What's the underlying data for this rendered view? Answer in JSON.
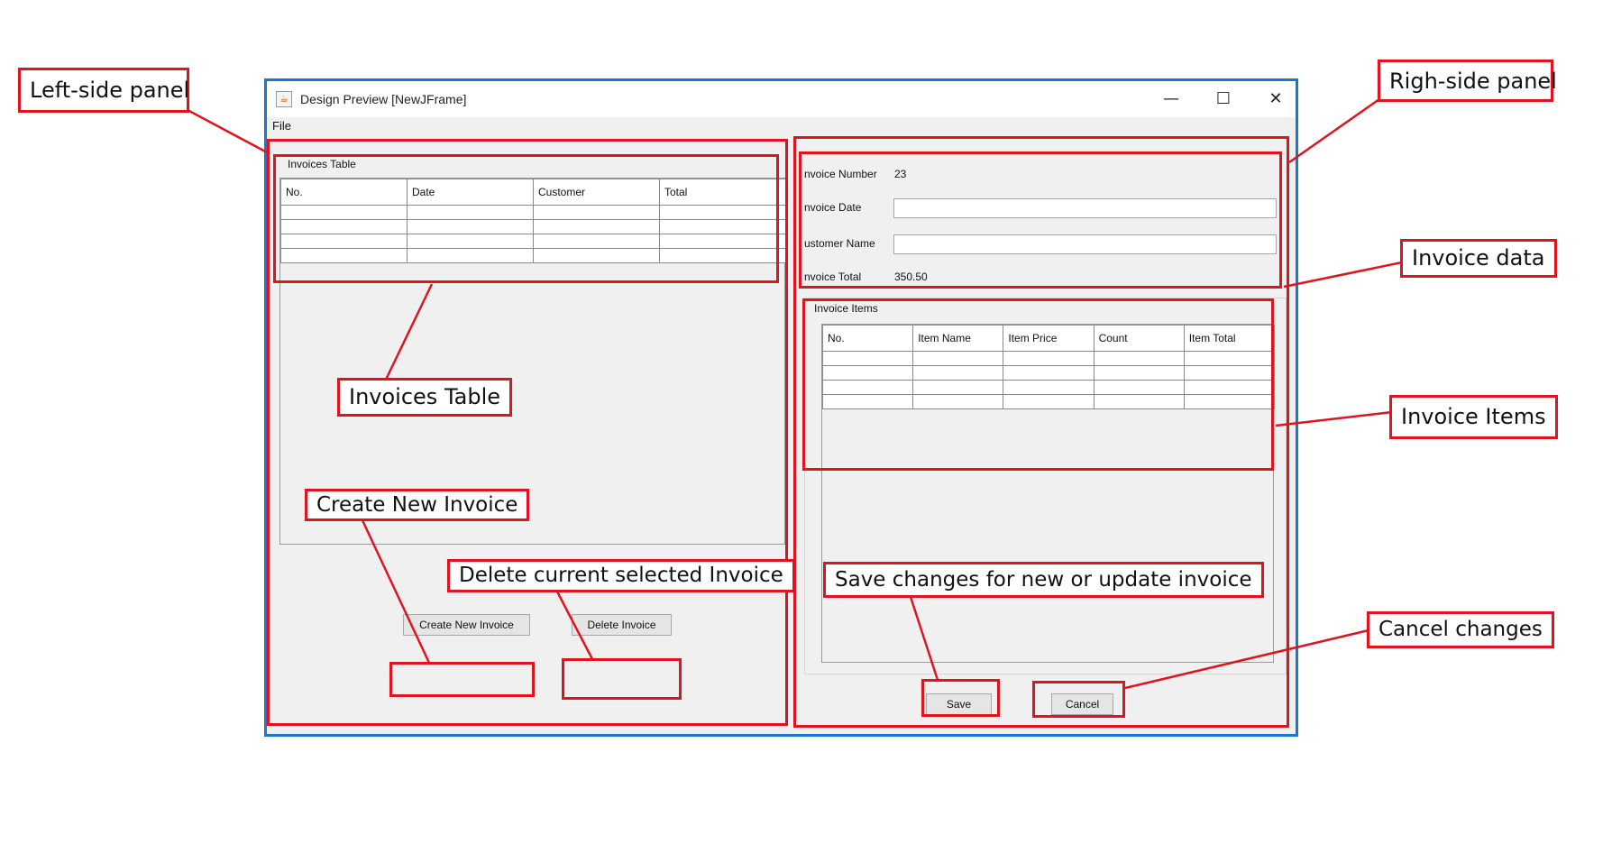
{
  "window": {
    "title": "Design Preview [NewJFrame]",
    "menu": {
      "file": "File"
    },
    "controls": {
      "minimize": "—",
      "maximize": "☐",
      "close": "✕"
    }
  },
  "left_panel": {
    "group_title": "Invoices Table",
    "columns": [
      "No.",
      "Date",
      "Customer",
      "Total"
    ],
    "rows": 4,
    "buttons": {
      "create": "Create New Invoice",
      "delete": "Delete Invoice"
    }
  },
  "right_panel": {
    "fields": {
      "invoice_number_label": "nvoice Number",
      "invoice_number_value": "23",
      "invoice_date_label": "nvoice Date",
      "invoice_date_value": "",
      "customer_name_label": "ustomer Name",
      "customer_name_value": "",
      "invoice_total_label": "nvoice Total",
      "invoice_total_value": "350.50"
    },
    "items_group_title": "Invoice Items",
    "columns": [
      "No.",
      "Item Name",
      "Item Price",
      "Count",
      "Item Total"
    ],
    "rows": 4,
    "buttons": {
      "save": "Save",
      "cancel": "Cancel"
    }
  },
  "annotations": {
    "left_side_panel": "Left-side panel",
    "right_side_panel": "Righ-side panel",
    "invoices_table": "Invoices Table",
    "invoice_data": "Invoice data",
    "invoice_items": "Invoice Items",
    "create_new_invoice": "Create New Invoice",
    "delete_invoice": "Delete current selected Invoice",
    "save_changes": "Save changes for new or update invoice",
    "cancel_changes": "Cancel changes"
  },
  "colors": {
    "annotation_red": "#e0141e",
    "window_border": "#1976d2",
    "panel_bg": "#f0f0f0"
  }
}
